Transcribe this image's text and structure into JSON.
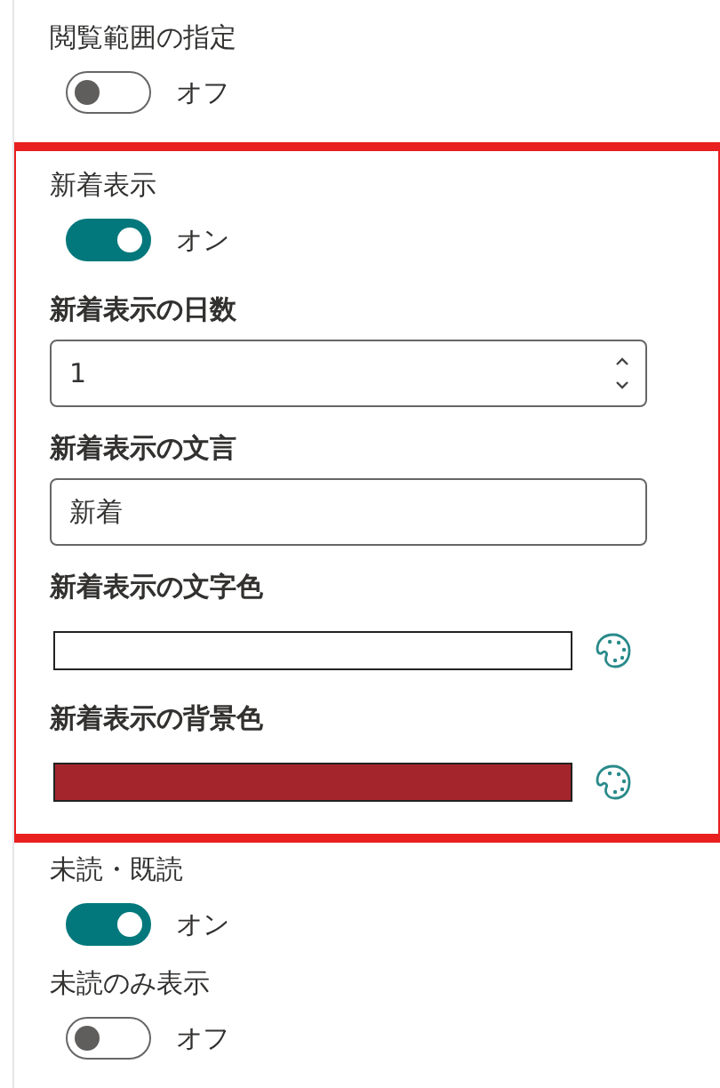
{
  "sections": [
    {
      "highlighted": false,
      "settings": [
        {
          "kind": "toggle",
          "label": "閲覧範囲の指定",
          "on": false,
          "state_text": "オフ"
        }
      ]
    },
    {
      "highlighted": true,
      "settings": [
        {
          "kind": "toggle",
          "label": "新着表示",
          "on": true,
          "state_text": "オン"
        },
        {
          "kind": "number",
          "label": "新着表示の日数",
          "value": "1"
        },
        {
          "kind": "text",
          "label": "新着表示の文言",
          "value": "新着"
        },
        {
          "kind": "color",
          "label": "新着表示の文字色",
          "color": "#ffffff"
        },
        {
          "kind": "color",
          "label": "新着表示の背景色",
          "color": "#a4262c"
        }
      ]
    },
    {
      "highlighted": false,
      "settings": [
        {
          "kind": "toggle",
          "label": "未読・既読",
          "on": true,
          "state_text": "オン"
        },
        {
          "kind": "toggle",
          "label": "未読のみ表示",
          "on": false,
          "state_text": "オフ"
        }
      ]
    }
  ]
}
